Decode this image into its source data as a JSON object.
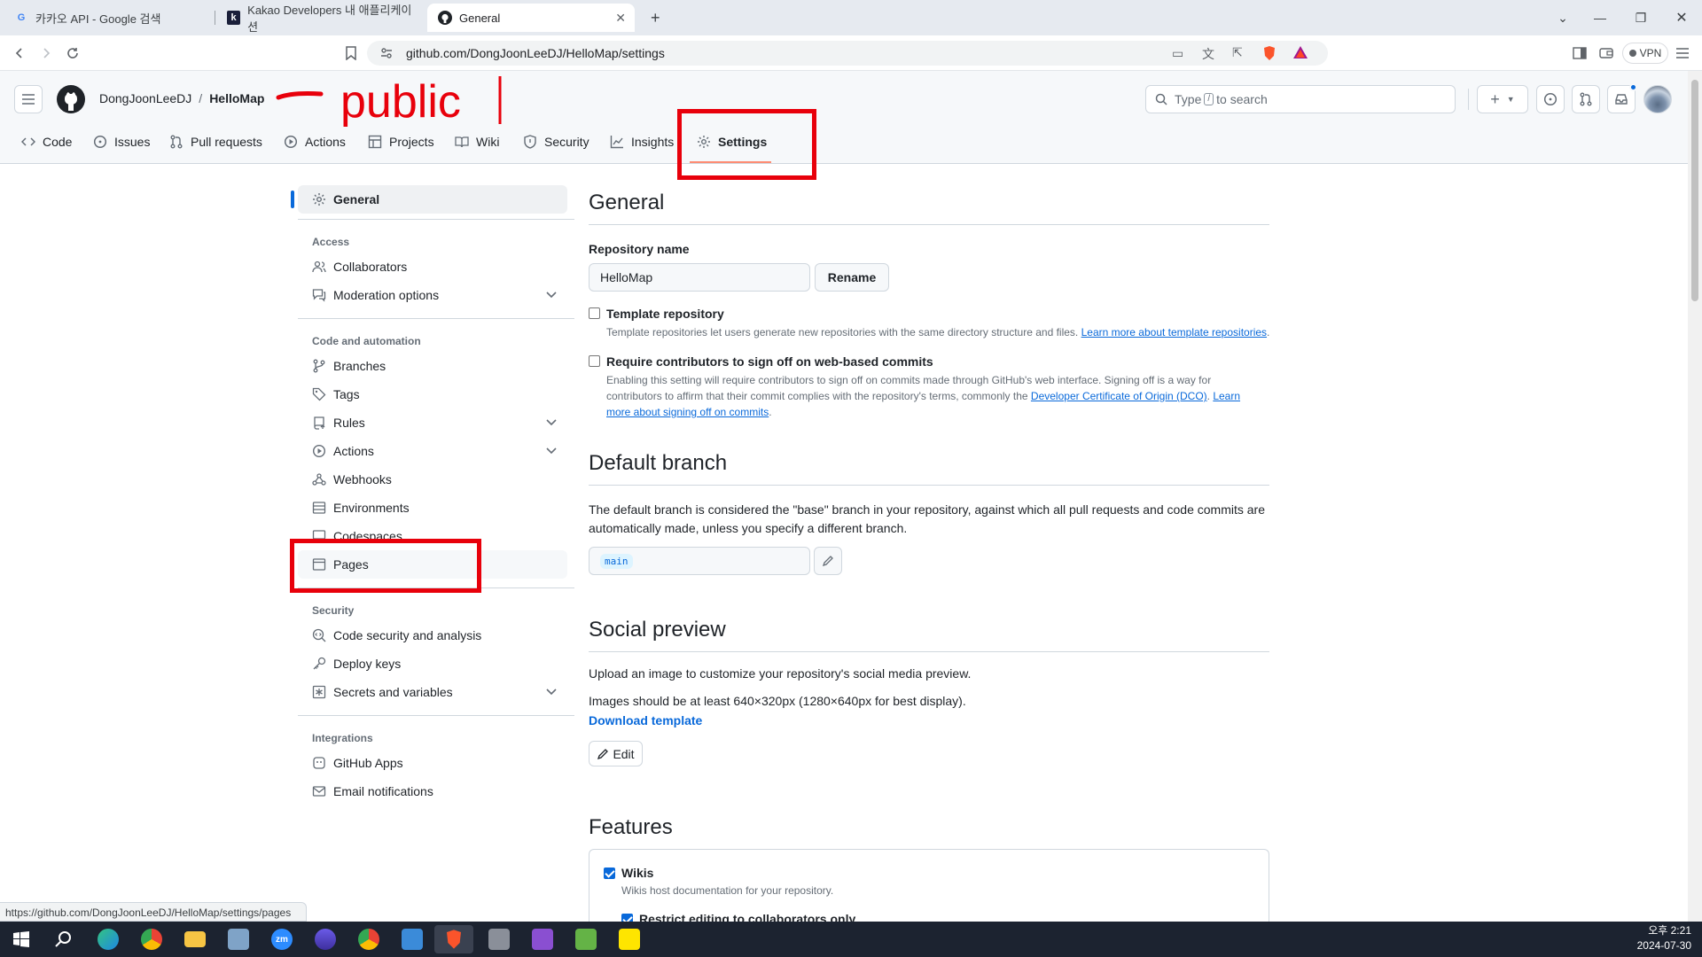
{
  "browser": {
    "tabs": [
      {
        "title": "카카오 API - Google 검색",
        "icon": "google-g-icon"
      },
      {
        "title": "Kakao Developers 내 애플리케이션",
        "icon": "kakao-k-icon"
      },
      {
        "title": "General",
        "icon": "github-icon"
      }
    ],
    "url": "github.com/DongJoonLeeDJ/HelloMap/settings",
    "vpn_label": "VPN",
    "status_url": "https://github.com/DongJoonLeeDJ/HelloMap/settings/pages"
  },
  "repo": {
    "owner": "DongJoonLeeDJ",
    "name": "HelloMap",
    "separator": "/"
  },
  "search": {
    "prefix": "Type",
    "key": "/",
    "suffix": "to search"
  },
  "nav": {
    "tabs": [
      "Code",
      "Issues",
      "Pull requests",
      "Actions",
      "Projects",
      "Wiki",
      "Security",
      "Insights",
      "Settings"
    ]
  },
  "sidebar": {
    "general": "General",
    "sections": {
      "access": "Access",
      "code_automation": "Code and automation",
      "security": "Security",
      "integrations": "Integrations"
    },
    "items": {
      "collaborators": "Collaborators",
      "moderation": "Moderation options",
      "branches": "Branches",
      "tags": "Tags",
      "rules": "Rules",
      "actions": "Actions",
      "webhooks": "Webhooks",
      "environments": "Environments",
      "codespaces": "Codespaces",
      "pages": "Pages",
      "code_security": "Code security and analysis",
      "deploy_keys": "Deploy keys",
      "secrets": "Secrets and variables",
      "github_apps": "GitHub Apps",
      "email_notifications": "Email notifications"
    }
  },
  "main": {
    "title": "General",
    "repo_name_label": "Repository name",
    "repo_name_value": "HelloMap",
    "rename_button": "Rename",
    "template": {
      "label": "Template repository",
      "desc": "Template repositories let users generate new repositories with the same directory structure and files.",
      "link": "Learn more about template repositories",
      "checked": false
    },
    "signoff": {
      "label": "Require contributors to sign off on web-based commits",
      "desc_line1": "Enabling this setting will require contributors to sign off on commits made through GitHub's web interface. Signing off is a way for",
      "desc_line2": "contributors to affirm that their commit complies with the repository's terms, commonly the",
      "link1": "Developer Certificate of Origin (DCO)",
      "link2_part1": "Learn",
      "link2_part2": "more about signing off on commits",
      "checked": false
    },
    "default_branch": {
      "title": "Default branch",
      "desc_line1": "The default branch is considered the \"base\" branch in your repository, against which all pull requests and code commits are",
      "desc_line2": "automatically made, unless you specify a different branch.",
      "value": "main"
    },
    "social_preview": {
      "title": "Social preview",
      "line1": "Upload an image to customize your repository's social media preview.",
      "line2": "Images should be at least 640×320px (1280×640px for best display).",
      "download": "Download template",
      "edit": "Edit"
    },
    "features": {
      "title": "Features",
      "wikis_label": "Wikis",
      "wikis_checked": true,
      "wikis_desc": "Wikis host documentation for your repository.",
      "restrict_label": "Restrict editing to collaborators only",
      "restrict_checked": true
    }
  },
  "annotation": {
    "text": "— public |",
    "color": "#e8000b"
  },
  "taskbar": {
    "time": "오후 2:21",
    "date": "2024-07-30"
  }
}
